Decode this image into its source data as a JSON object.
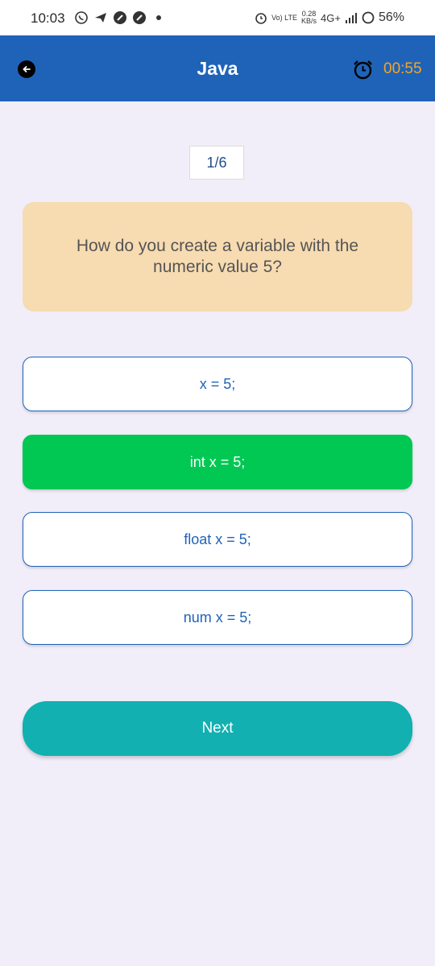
{
  "status_bar": {
    "time": "10:03",
    "left_icons": [
      "whatsapp-icon",
      "telegram-icon",
      "app-icon",
      "app-icon",
      "dot-icon"
    ],
    "volte": "Vo) LTE",
    "speed_value": "0.28",
    "speed_unit": "KB/s",
    "network": "4G+",
    "battery": "56%"
  },
  "app_bar": {
    "title": "Java",
    "timer": "00:55",
    "back_icon": "back-arrow-icon",
    "timer_icon": "alarm-clock-icon",
    "color": "#1f63b8",
    "timer_color": "#f5a623"
  },
  "quiz": {
    "counter": "1/6",
    "question": "How do you create a variable with the numeric value 5?",
    "options": [
      {
        "label": "x = 5;",
        "selected": false
      },
      {
        "label": "int x = 5;",
        "selected": true
      },
      {
        "label": "float x = 5;",
        "selected": false
      },
      {
        "label": "num x = 5;",
        "selected": false
      }
    ],
    "selected_color": "#00c853",
    "next_label": "Next",
    "next_color": "#12b0b1"
  }
}
